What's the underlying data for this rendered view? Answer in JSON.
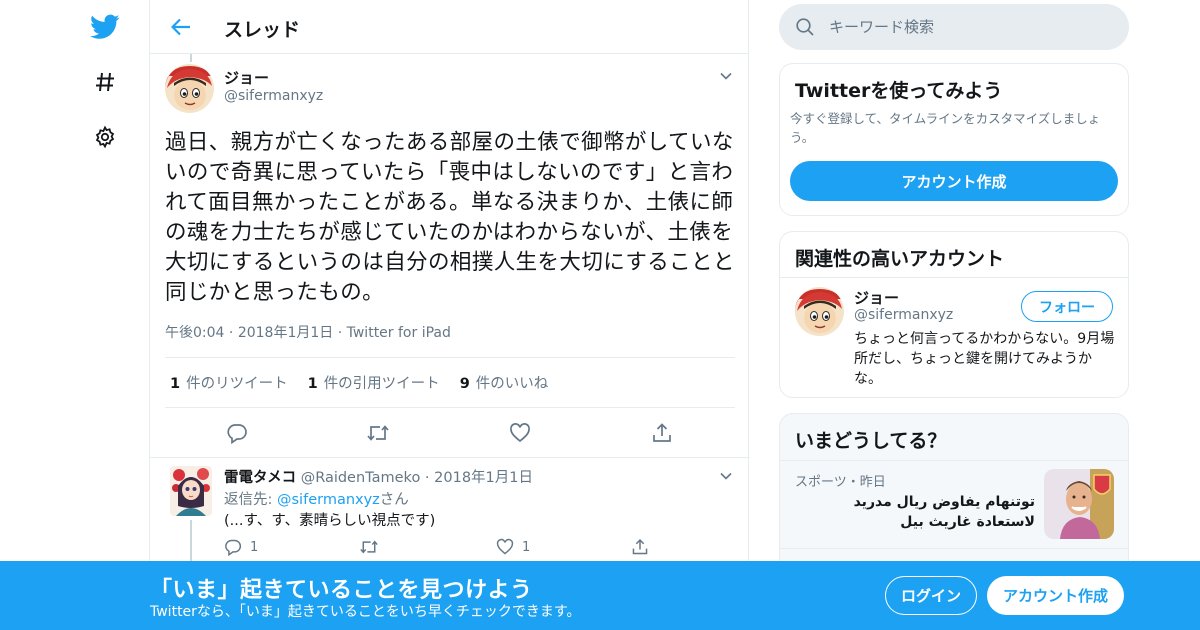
{
  "brand": {
    "accent": "#1da1f2",
    "text": "#14171a",
    "muted": "#657786"
  },
  "nav": {
    "icons": [
      "twitter-bird-icon",
      "hashtag-icon",
      "gear-icon"
    ]
  },
  "header": {
    "title": "スレッド"
  },
  "tweet": {
    "author_name": "ジョー",
    "author_handle": "@sifermanxyz",
    "text": "過日、親方が亡くなったある部屋の土俵で御幣がしていないので奇異に思っていたら「喪中はしないのです」と言われて面目無かったことがある。単なる決まりか、土俵に師の魂を力士たちが感じていたのかはわからないが、土俵を大切にするというのは自分の相撲人生を大切にすることと同じかと思ったもの。",
    "time": "午後0:04",
    "date": "2018年1月1日",
    "source": "Twitter for iPad",
    "retweets_count": "1",
    "retweets_label": "件のリツイート",
    "quotes_count": "1",
    "quotes_label": "件の引用ツイート",
    "likes_count": "9",
    "likes_label": "件のいいね"
  },
  "reply": {
    "name": "雷電タメコ",
    "handle": "@RaidenTameko",
    "date": "2018年1月1日",
    "reply_to_prefix": "返信先: ",
    "reply_to_handle": "@sifermanxyz",
    "reply_to_suffix": "さん",
    "text": "(...す、す、素晴らしい視点です)",
    "reply_count": "1",
    "like_count": "1"
  },
  "search": {
    "placeholder": "キーワード検索"
  },
  "signup_card": {
    "title": "Twitterを使ってみよう",
    "desc": "今すぐ登録して、タイムラインをカスタマイズしましょう。",
    "button": "アカウント作成"
  },
  "related_card": {
    "title": "関連性の高いアカウント",
    "name": "ジョー",
    "handle": "@sifermanxyz",
    "follow": "フォロー",
    "bio": "ちょっと何言ってるかわからない。9月場所だし、ちょっと鍵を開けてみようかな。"
  },
  "trends_card": {
    "title": "いまどうしてる？",
    "meta": "スポーツ・昨日",
    "headline": "توتنهام يفاوض ريال مدريد لاستعادة غاريث بيل"
  },
  "banner": {
    "title": "「いま」起きていることを見つけよう",
    "subtitle": "Twitterなら、「いま」起きていることをいち早くチェックできます。",
    "login": "ログイン",
    "signup": "アカウント作成"
  }
}
